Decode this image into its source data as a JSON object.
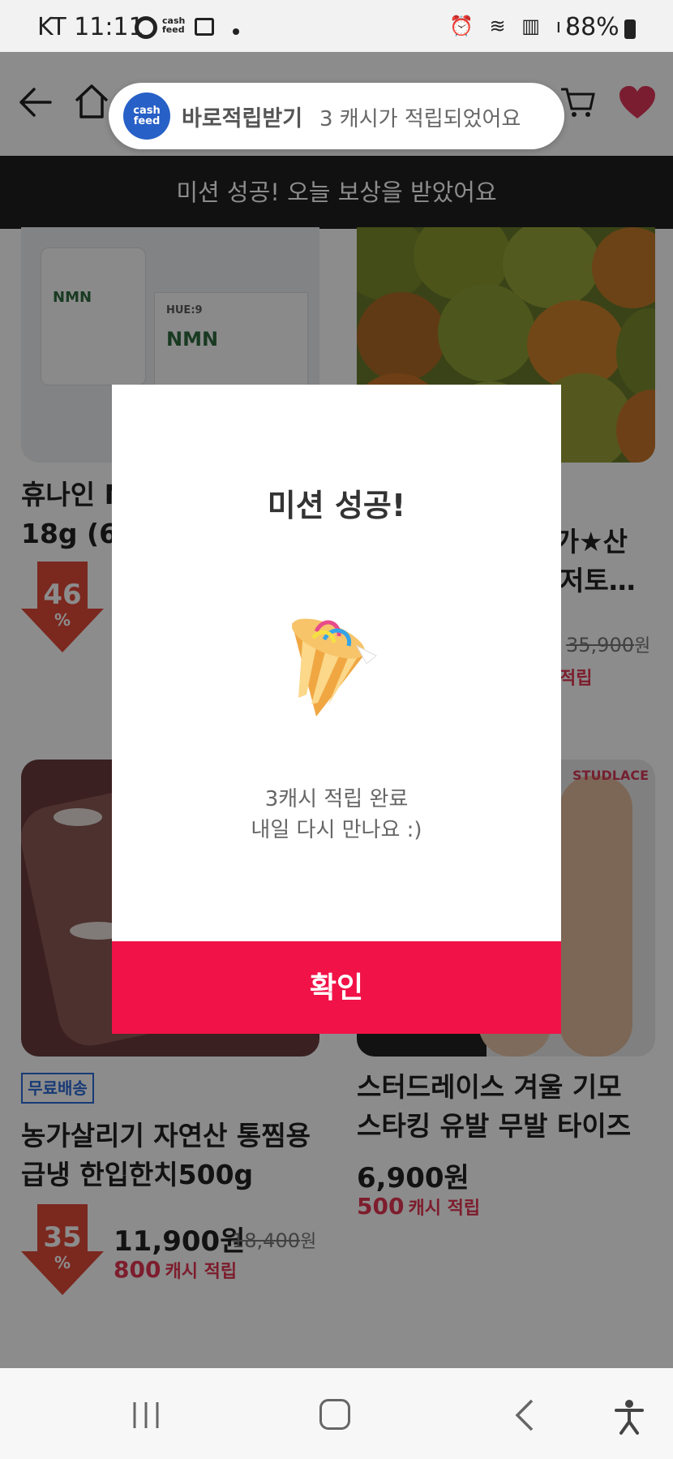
{
  "status_bar": {
    "carrier_time": "KT 11:11",
    "cashfeed_small": "cash feed",
    "battery": "88%"
  },
  "toast": {
    "logo_text": "cash feed",
    "title": "바로적립받기",
    "message": "3 캐시가 적립되었어요"
  },
  "notice_bar": "미션 성공! 오늘 보상을 받았어요",
  "products": [
    {
      "title_line1": "휴나인 NMN",
      "title_line2": "18g (60",
      "discount": "46",
      "discount_unit": "%",
      "box_brand": "HUE:9",
      "box_label": "NMN"
    },
    {
      "title_line1": "-가★산",
      "title_line2": "저토…",
      "orig_price": "35,900",
      "won": "원",
      "cash_suffix": "적립"
    },
    {
      "badge": "무료배송",
      "title_line1": "농가살리기 자연산 통찜용",
      "title_line2": "급냉 한입한치500g",
      "discount": "35",
      "discount_unit": "%",
      "price": "11,900원",
      "orig_price": "18,400",
      "won": "원",
      "cash_amount": "800",
      "cash_label": "캐시 적립"
    },
    {
      "brand_tag": "STUDLACE",
      "title_line1": "스터드레이스 겨울 기모",
      "title_line2": "스타킹 유발 무발 타이즈",
      "price": "6,900원",
      "cash_amount": "500",
      "cash_label": "캐시 적립"
    }
  ],
  "modal": {
    "title": "미션 성공!",
    "message_line1": "3캐시 적립 완료",
    "message_line2": "내일 다시 만나요 :)",
    "confirm_label": "확인",
    "confirm_color": "#f11247"
  },
  "icons": {
    "back": "back-arrow-icon",
    "home": "home-icon",
    "cart": "cart-icon",
    "wishlist": "heart-icon",
    "party": "party-popper-icon"
  },
  "colors": {
    "accent": "#f11247",
    "cash_red": "#e33553",
    "discount_red": "#e04a3a",
    "heart": "#e0355a",
    "notice_bg": "#1f1f1f",
    "cashfeed_blue": "#2760c6"
  }
}
